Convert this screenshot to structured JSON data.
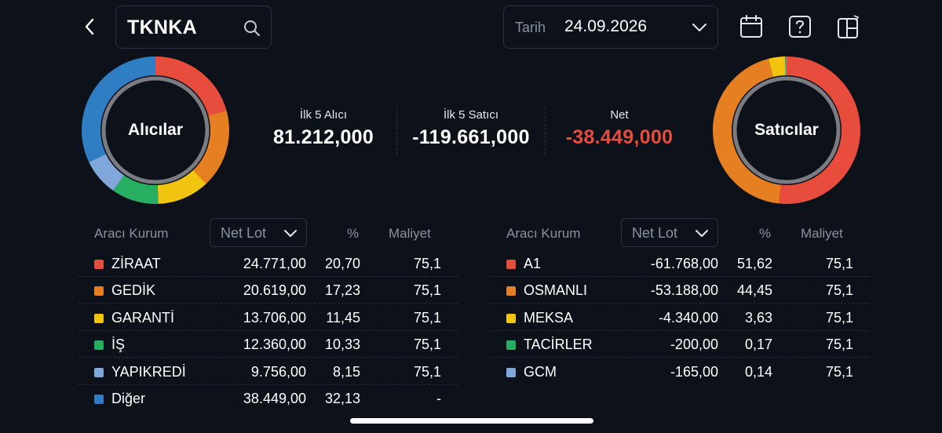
{
  "header": {
    "symbol": "TKNKA",
    "date_label": "Tarih",
    "date_value": "24.09.2026"
  },
  "icons": {
    "back": "chevron-left-icon",
    "search": "search-icon",
    "date_dropdown": "chevron-down-icon",
    "calendar": "calendar-icon",
    "help": "question-icon",
    "layout": "layout-switch-icon"
  },
  "summary": {
    "buyers_donut_label": "Alıcılar",
    "sellers_donut_label": "Satıcılar",
    "top5_buyer_label": "İlk 5 Alıcı",
    "top5_buyer_value": "81.212,000",
    "top5_seller_label": "İlk 5 Satıcı",
    "top5_seller_value": "-119.661,000",
    "net_label": "Net",
    "net_value": "-38.449,000"
  },
  "columns": {
    "broker": "Aracı Kurum",
    "net_lot": "Net Lot",
    "percent": "%",
    "cost": "Maliyet"
  },
  "buyers": [
    {
      "name": "ZİRAAT",
      "net_lot": "24.771,00",
      "percent": "20,70",
      "cost": "75,1",
      "color": "#e74c3c",
      "share": 20.7
    },
    {
      "name": "GEDİK",
      "net_lot": "20.619,00",
      "percent": "17,23",
      "cost": "75,1",
      "color": "#e67e22",
      "share": 17.23
    },
    {
      "name": "GARANTİ",
      "net_lot": "13.706,00",
      "percent": "11,45",
      "cost": "75,1",
      "color": "#f1c40f",
      "share": 11.45
    },
    {
      "name": "İŞ",
      "net_lot": "12.360,00",
      "percent": "10,33",
      "cost": "75,1",
      "color": "#27ae60",
      "share": 10.33
    },
    {
      "name": "YAPIKREDİ",
      "net_lot": "9.756,00",
      "percent": "8,15",
      "cost": "75,1",
      "color": "#7fa7d9",
      "share": 8.15
    },
    {
      "name": "Diğer",
      "net_lot": "38.449,00",
      "percent": "32,13",
      "cost": "-",
      "color": "#2f7ec4",
      "share": 32.13
    }
  ],
  "sellers": [
    {
      "name": "A1",
      "net_lot": "-61.768,00",
      "percent": "51,62",
      "cost": "75,1",
      "color": "#e74c3c",
      "share": 51.62
    },
    {
      "name": "OSMANLI",
      "net_lot": "-53.188,00",
      "percent": "44,45",
      "cost": "75,1",
      "color": "#e67e22",
      "share": 44.45
    },
    {
      "name": "MEKSA",
      "net_lot": "-4.340,00",
      "percent": "3,63",
      "cost": "75,1",
      "color": "#f1c40f",
      "share": 3.63
    },
    {
      "name": "TACİRLER",
      "net_lot": "-200,00",
      "percent": "0,17",
      "cost": "75,1",
      "color": "#27ae60",
      "share": 0.17
    },
    {
      "name": "GCM",
      "net_lot": "-165,00",
      "percent": "0,14",
      "cost": "75,1",
      "color": "#7fa7d9",
      "share": 0.14
    }
  ],
  "colors": {
    "background": "#0d111a",
    "negative": "#e74c3c",
    "muted": "#8b91a1"
  }
}
